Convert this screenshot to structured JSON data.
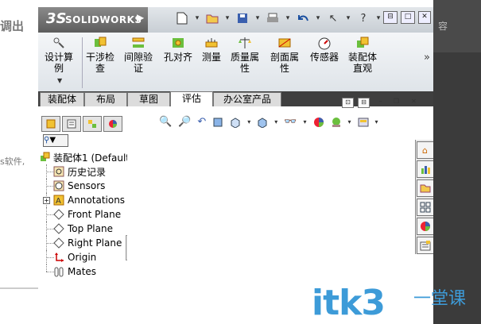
{
  "background": {
    "left_text_1": "调出",
    "left_text_2": "s软件,",
    "right_text": "容",
    "watermark": "itk3",
    "watermark_tail": "一堂课",
    "watermark_sub": "—"
  },
  "app": {
    "logo_ds": "3S",
    "name": "SOLIDWORKS",
    "menu_arrow": "▶"
  },
  "toolbar_icons": [
    "new-doc-icon",
    "open-folder-icon",
    "save-icon",
    "print-icon",
    "undo-icon",
    "select-icon",
    "help-icon"
  ],
  "ribbon": {
    "buttons": [
      {
        "label_1": "设计算",
        "label_2": "例",
        "icon": "design-study-icon"
      },
      {
        "label_1": "干涉检",
        "label_2": "查",
        "icon": "interference-icon"
      },
      {
        "label_1": "间隙验",
        "label_2": "证",
        "icon": "clearance-icon"
      },
      {
        "label_1": "孔对齐",
        "label_2": "",
        "icon": "hole-align-icon"
      },
      {
        "label_1": "测量",
        "label_2": "",
        "icon": "measure-icon"
      },
      {
        "label_1": "质量属",
        "label_2": "性",
        "icon": "mass-props-icon"
      },
      {
        "label_1": "剖面属",
        "label_2": "性",
        "icon": "section-props-icon"
      },
      {
        "label_1": "传感器",
        "label_2": "",
        "icon": "sensor-icon"
      },
      {
        "label_1": "装配体",
        "label_2": "直观",
        "icon": "assembly-visual-icon"
      }
    ],
    "more": "»"
  },
  "tabs": [
    "装配体",
    "布局",
    "草图",
    "评估",
    "办公室产品"
  ],
  "active_tab": "评估",
  "tree": {
    "root": "装配体1  (Default",
    "items": [
      {
        "label": "历史记录",
        "icon": "history-icon"
      },
      {
        "label": "Sensors",
        "icon": "sensors-icon"
      },
      {
        "label": "Annotations",
        "icon": "annotations-icon"
      },
      {
        "label": "Front Plane",
        "icon": "plane-icon"
      },
      {
        "label": "Top Plane",
        "icon": "plane-icon"
      },
      {
        "label": "Right Plane",
        "icon": "plane-icon"
      },
      {
        "label": "Origin",
        "icon": "origin-icon"
      },
      {
        "label": "Mates",
        "icon": "mates-icon"
      }
    ]
  },
  "filter_label": "▼",
  "colors": {
    "ribbon_bg": "#e6ebf0",
    "tab_bar": "#3f3f3f",
    "watermark": "#3d9bd8"
  }
}
